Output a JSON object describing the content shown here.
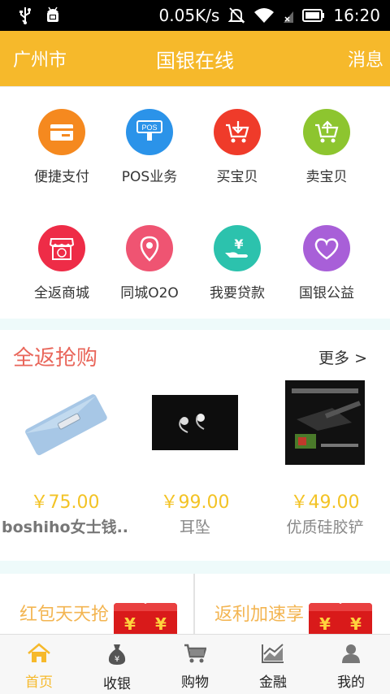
{
  "status_bar": {
    "network_speed": "0.05K/s",
    "time": "16:20",
    "icons": [
      "usb-icon",
      "android-debug-icon",
      "mute-icon",
      "wifi-icon",
      "signal-icon",
      "battery-icon"
    ]
  },
  "header": {
    "city": "广州市",
    "title": "国银在线",
    "message": "消息",
    "bg_color": "#f6b92b"
  },
  "grid": {
    "items": [
      {
        "label": "便捷支付",
        "icon": "card-icon",
        "color": "#f5891f"
      },
      {
        "label": "POS业务",
        "icon": "pos-terminal-icon",
        "color": "#2b93e9"
      },
      {
        "label": "买宝贝",
        "icon": "cart-download-icon",
        "color": "#ef3b2a"
      },
      {
        "label": "卖宝贝",
        "icon": "cart-upload-icon",
        "color": "#8dc52f"
      },
      {
        "label": "全返商城",
        "icon": "store-icon",
        "color": "#ee2c47"
      },
      {
        "label": "同城O2O",
        "icon": "location-pin-icon",
        "color": "#ef5472"
      },
      {
        "label": "我要贷款",
        "icon": "loan-hand-icon",
        "color": "#2cc2ad"
      },
      {
        "label": "国银公益",
        "icon": "heart-icon",
        "color": "#a85fd8"
      }
    ]
  },
  "quick_buy": {
    "title": "全返抢购",
    "more": "更多 >",
    "products": [
      {
        "price": "￥75.00",
        "name": "boshiho女士钱...",
        "image": "wallet-image"
      },
      {
        "price": "￥99.00",
        "name": "耳坠",
        "image": "earrings-image"
      },
      {
        "price": "￥49.00",
        "name": "优质硅胶铲",
        "image": "spatula-image"
      }
    ]
  },
  "banners": [
    {
      "text": "红包天天抢"
    },
    {
      "text": "返利加速享"
    }
  ],
  "tabs": [
    {
      "label": "首页",
      "icon": "home-icon",
      "active": true
    },
    {
      "label": "收银",
      "icon": "money-bag-icon",
      "active": false
    },
    {
      "label": "购物",
      "icon": "shopping-cart-icon",
      "active": false
    },
    {
      "label": "金融",
      "icon": "chart-icon",
      "active": false
    },
    {
      "label": "我的",
      "icon": "user-icon",
      "active": false
    }
  ]
}
